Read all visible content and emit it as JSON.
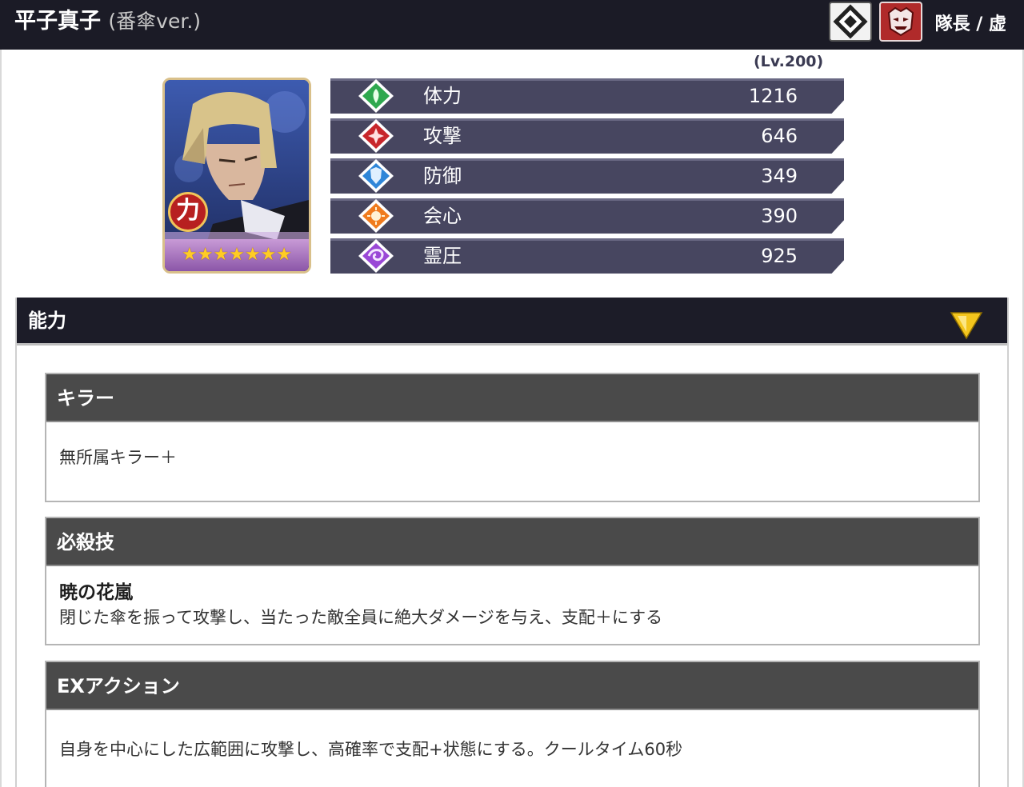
{
  "header": {
    "name": "平子真子",
    "variant": "(番傘ver.)",
    "type_icons": [
      "power-type-icon",
      "hollow-mask-icon"
    ],
    "rank": "隊長 / 虚"
  },
  "card": {
    "attribute_glyph": "力",
    "stars": "★★★★★★★",
    "rarity_stars": 7
  },
  "stats": {
    "level": "(Lv.200)",
    "rows": [
      {
        "label": "体力",
        "value": "1216",
        "icon": "hp-leaf-icon",
        "color": "#2fa84f"
      },
      {
        "label": "攻撃",
        "value": "646",
        "icon": "attack-icon",
        "color": "#c8262b"
      },
      {
        "label": "防御",
        "value": "349",
        "icon": "defense-shield-icon",
        "color": "#2f86d8"
      },
      {
        "label": "会心",
        "value": "390",
        "icon": "critical-sun-icon",
        "color": "#f07b1e"
      },
      {
        "label": "霊圧",
        "value": "925",
        "icon": "spirit-pressure-icon",
        "color": "#9a48d6"
      }
    ]
  },
  "abilities": {
    "heading": "能力",
    "toggle_icon": "collapse-triangle-icon",
    "toggle_color": "#f3c51d",
    "killer": {
      "title": "キラー",
      "text": "無所属キラー＋"
    },
    "special": {
      "title": "必殺技",
      "name": "暁の花嵐",
      "text": "閉じた傘を振って攻撃し、当たった敵全員に絶大ダメージを与え、支配＋にする"
    },
    "ex_action": {
      "title": "EXアクション",
      "text": "自身を中心にした広範囲に攻撃し、高確率で支配+状態にする。クールタイム60秒"
    }
  }
}
